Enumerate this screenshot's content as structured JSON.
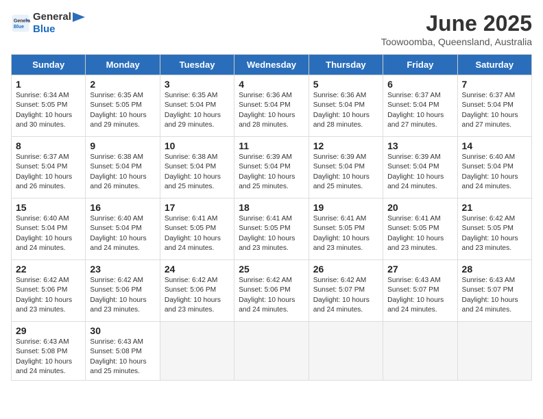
{
  "header": {
    "logo_line1": "General",
    "logo_line2": "Blue",
    "month_title": "June 2025",
    "location": "Toowoomba, Queensland, Australia"
  },
  "weekdays": [
    "Sunday",
    "Monday",
    "Tuesday",
    "Wednesday",
    "Thursday",
    "Friday",
    "Saturday"
  ],
  "weeks": [
    [
      {
        "day": "1",
        "info": "Sunrise: 6:34 AM\nSunset: 5:05 PM\nDaylight: 10 hours\nand 30 minutes."
      },
      {
        "day": "2",
        "info": "Sunrise: 6:35 AM\nSunset: 5:05 PM\nDaylight: 10 hours\nand 29 minutes."
      },
      {
        "day": "3",
        "info": "Sunrise: 6:35 AM\nSunset: 5:04 PM\nDaylight: 10 hours\nand 29 minutes."
      },
      {
        "day": "4",
        "info": "Sunrise: 6:36 AM\nSunset: 5:04 PM\nDaylight: 10 hours\nand 28 minutes."
      },
      {
        "day": "5",
        "info": "Sunrise: 6:36 AM\nSunset: 5:04 PM\nDaylight: 10 hours\nand 28 minutes."
      },
      {
        "day": "6",
        "info": "Sunrise: 6:37 AM\nSunset: 5:04 PM\nDaylight: 10 hours\nand 27 minutes."
      },
      {
        "day": "7",
        "info": "Sunrise: 6:37 AM\nSunset: 5:04 PM\nDaylight: 10 hours\nand 27 minutes."
      }
    ],
    [
      {
        "day": "8",
        "info": "Sunrise: 6:37 AM\nSunset: 5:04 PM\nDaylight: 10 hours\nand 26 minutes."
      },
      {
        "day": "9",
        "info": "Sunrise: 6:38 AM\nSunset: 5:04 PM\nDaylight: 10 hours\nand 26 minutes."
      },
      {
        "day": "10",
        "info": "Sunrise: 6:38 AM\nSunset: 5:04 PM\nDaylight: 10 hours\nand 25 minutes."
      },
      {
        "day": "11",
        "info": "Sunrise: 6:39 AM\nSunset: 5:04 PM\nDaylight: 10 hours\nand 25 minutes."
      },
      {
        "day": "12",
        "info": "Sunrise: 6:39 AM\nSunset: 5:04 PM\nDaylight: 10 hours\nand 25 minutes."
      },
      {
        "day": "13",
        "info": "Sunrise: 6:39 AM\nSunset: 5:04 PM\nDaylight: 10 hours\nand 24 minutes."
      },
      {
        "day": "14",
        "info": "Sunrise: 6:40 AM\nSunset: 5:04 PM\nDaylight: 10 hours\nand 24 minutes."
      }
    ],
    [
      {
        "day": "15",
        "info": "Sunrise: 6:40 AM\nSunset: 5:04 PM\nDaylight: 10 hours\nand 24 minutes."
      },
      {
        "day": "16",
        "info": "Sunrise: 6:40 AM\nSunset: 5:04 PM\nDaylight: 10 hours\nand 24 minutes."
      },
      {
        "day": "17",
        "info": "Sunrise: 6:41 AM\nSunset: 5:05 PM\nDaylight: 10 hours\nand 24 minutes."
      },
      {
        "day": "18",
        "info": "Sunrise: 6:41 AM\nSunset: 5:05 PM\nDaylight: 10 hours\nand 23 minutes."
      },
      {
        "day": "19",
        "info": "Sunrise: 6:41 AM\nSunset: 5:05 PM\nDaylight: 10 hours\nand 23 minutes."
      },
      {
        "day": "20",
        "info": "Sunrise: 6:41 AM\nSunset: 5:05 PM\nDaylight: 10 hours\nand 23 minutes."
      },
      {
        "day": "21",
        "info": "Sunrise: 6:42 AM\nSunset: 5:05 PM\nDaylight: 10 hours\nand 23 minutes."
      }
    ],
    [
      {
        "day": "22",
        "info": "Sunrise: 6:42 AM\nSunset: 5:06 PM\nDaylight: 10 hours\nand 23 minutes."
      },
      {
        "day": "23",
        "info": "Sunrise: 6:42 AM\nSunset: 5:06 PM\nDaylight: 10 hours\nand 23 minutes."
      },
      {
        "day": "24",
        "info": "Sunrise: 6:42 AM\nSunset: 5:06 PM\nDaylight: 10 hours\nand 23 minutes."
      },
      {
        "day": "25",
        "info": "Sunrise: 6:42 AM\nSunset: 5:06 PM\nDaylight: 10 hours\nand 24 minutes."
      },
      {
        "day": "26",
        "info": "Sunrise: 6:42 AM\nSunset: 5:07 PM\nDaylight: 10 hours\nand 24 minutes."
      },
      {
        "day": "27",
        "info": "Sunrise: 6:43 AM\nSunset: 5:07 PM\nDaylight: 10 hours\nand 24 minutes."
      },
      {
        "day": "28",
        "info": "Sunrise: 6:43 AM\nSunset: 5:07 PM\nDaylight: 10 hours\nand 24 minutes."
      }
    ],
    [
      {
        "day": "29",
        "info": "Sunrise: 6:43 AM\nSunset: 5:08 PM\nDaylight: 10 hours\nand 24 minutes."
      },
      {
        "day": "30",
        "info": "Sunrise: 6:43 AM\nSunset: 5:08 PM\nDaylight: 10 hours\nand 25 minutes."
      },
      {
        "day": "",
        "info": ""
      },
      {
        "day": "",
        "info": ""
      },
      {
        "day": "",
        "info": ""
      },
      {
        "day": "",
        "info": ""
      },
      {
        "day": "",
        "info": ""
      }
    ]
  ]
}
